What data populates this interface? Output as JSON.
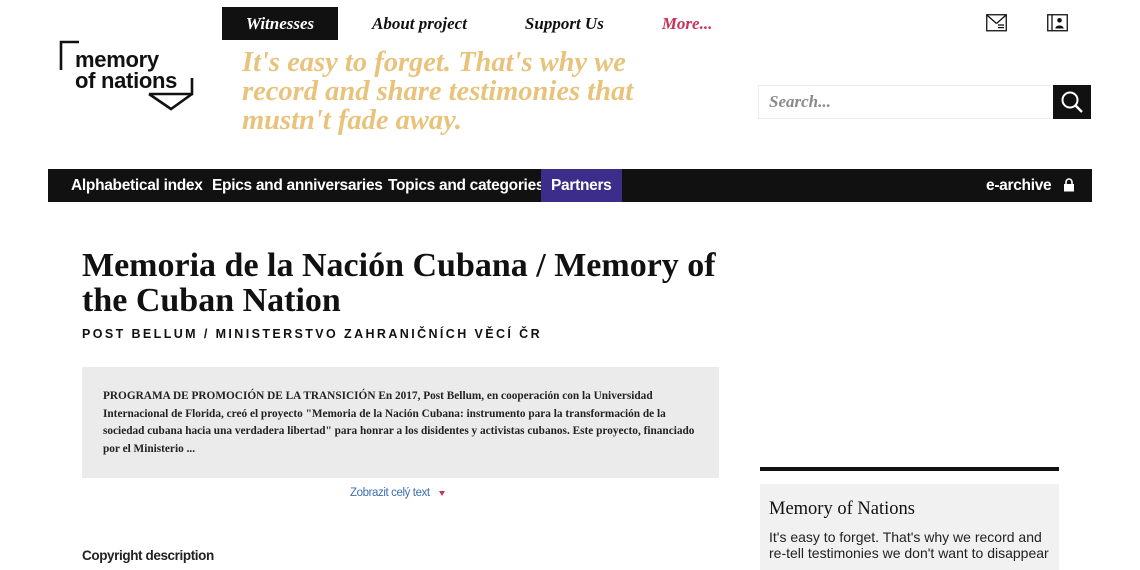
{
  "nav": {
    "items": [
      "Witnesses",
      "About project",
      "Support Us",
      "More..."
    ],
    "active": "Witnesses",
    "icons": [
      "newsletter-icon",
      "id-card-icon"
    ]
  },
  "logo": {
    "line1": "memory",
    "line2": "of nations"
  },
  "tagline": "It's easy to forget. That's why we record and share testimonies that mustn't fade away.",
  "search": {
    "placeholder": "Search...",
    "icon": "search-icon"
  },
  "categories": {
    "items": [
      "Alphabetical index",
      "Epics and anniversaries",
      "Topics and categories",
      "Partners"
    ],
    "active": "Partners",
    "archive": "e-archive",
    "archive_icon": "lock-icon"
  },
  "page": {
    "title": "Memoria de la Nación Cubana / Memory of the Cuban Nation",
    "subtitle": "POST BELLUM / MINISTERSTVO ZAHRANIČNÍCH VĚCÍ ČR",
    "description_heading": "PROGRAMA DE PROMOCIÓN DE LA TRANSICIÓN",
    "description": "En 2017, Post Bellum, en cooperación con la Universidad Internacional de Florida, creó el proyecto \"Memoria de la Nación Cubana: instrumento para la transformación de la sociedad cubana hacia una verdadera libertad\" para honrar a los disidentes y activistas cubanos. Este proyecto, financiado por el Ministerio ...",
    "show_more": "Zobrazit celý text",
    "copyright": "Copyright description"
  },
  "sidebar": {
    "card_title": "Memory of Nations",
    "card_text": "It's easy to forget. That's why we record and re-tell testimonies we don't want to disappear"
  },
  "colors": {
    "tagline": "#e8c37c",
    "accent": "#c8325c",
    "partners_bg": "#3c2d8a",
    "link": "#3b6fb0",
    "dark": "#111111"
  }
}
